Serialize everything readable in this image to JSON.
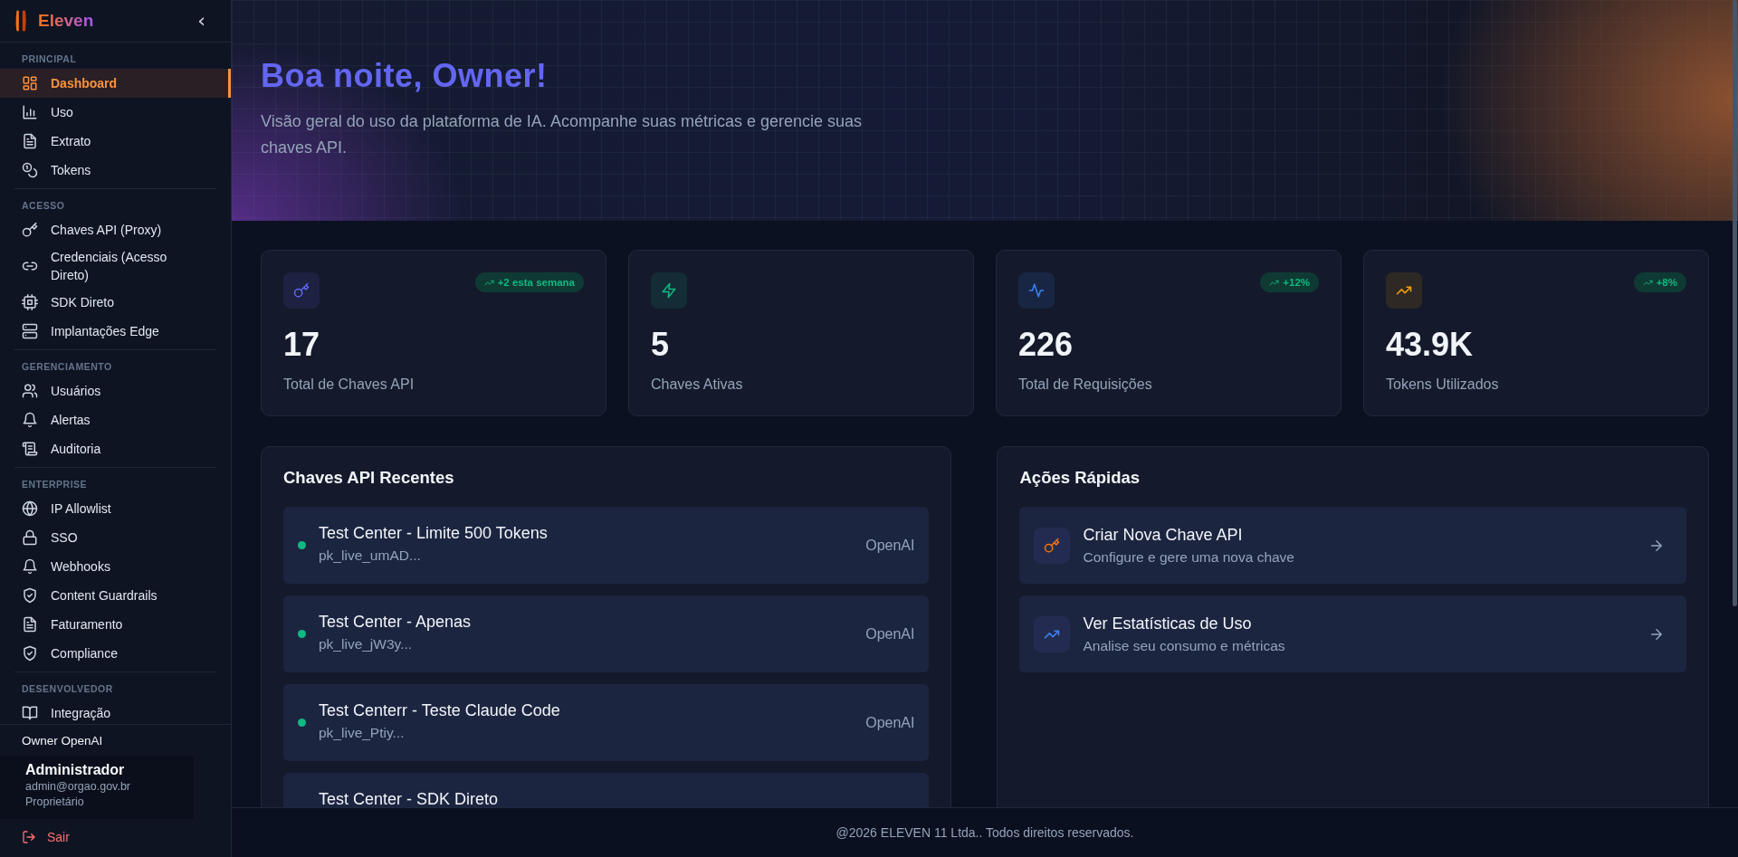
{
  "sidebar": {
    "logo": "Eleven",
    "collapse": "‹",
    "sections": [
      {
        "label": "PRINCIPAL",
        "items": [
          {
            "label": "Dashboard",
            "selected": true
          },
          {
            "label": "Uso",
            "selected": false
          },
          {
            "label": "Extrato",
            "selected": false
          },
          {
            "label": "Tokens",
            "selected": false
          }
        ]
      },
      {
        "label": "ACESSO",
        "items": [
          {
            "label": "Chaves API (Proxy)",
            "selected": false
          },
          {
            "label": "Credenciais (Acesso Direto)",
            "selected": false
          },
          {
            "label": "SDK Direto",
            "selected": false
          },
          {
            "label": "Implantações Edge",
            "selected": false
          }
        ]
      },
      {
        "label": "GERENCIAMENTO",
        "items": [
          {
            "label": "Usuários",
            "selected": false
          },
          {
            "label": "Alertas",
            "selected": false
          },
          {
            "label": "Auditoria",
            "selected": false
          }
        ]
      },
      {
        "label": "ENTERPRISE",
        "items": [
          {
            "label": "IP Allowlist",
            "selected": false
          },
          {
            "label": "SSO",
            "selected": false
          },
          {
            "label": "Webhooks",
            "selected": false
          },
          {
            "label": "Content Guardrails",
            "selected": false
          },
          {
            "label": "Faturamento",
            "selected": false
          },
          {
            "label": "Compliance",
            "selected": false
          }
        ]
      },
      {
        "label": "DESENVOLVEDOR",
        "items": [
          {
            "label": "Integração",
            "selected": false
          }
        ]
      }
    ],
    "account": "Owner OpenAI",
    "tooltip": {
      "name": "Administrador",
      "email": "admin@orgao.gov.br",
      "role": "Proprietário"
    },
    "logout": "Sair"
  },
  "header": {
    "title": "Boa noite, Owner!",
    "subtitle": "Visão geral do uso da plataforma de IA. Acompanhe suas métricas e gerencie suas chaves API."
  },
  "stats": [
    {
      "value": "17",
      "label": "Total de Chaves API",
      "badge": "+2 esta semana",
      "color": "#6366f1"
    },
    {
      "value": "5",
      "label": "Chaves Ativas",
      "color": "#10b981"
    },
    {
      "value": "226",
      "label": "Total de Requisições",
      "badge": "+12%",
      "color": "#3b82f6"
    },
    {
      "value": "43.9K",
      "label": "Tokens Utilizados",
      "badge": "+8%",
      "color": "#f59e0b"
    }
  ],
  "recent_keys": {
    "title": "Chaves API Recentes",
    "items": [
      {
        "name": "Test Center - Limite 500 Tokens",
        "key": "pk_live_umAD...",
        "provider": "OpenAI",
        "active": true
      },
      {
        "name": "Test Center - Apenas",
        "key": "pk_live_jW3y...",
        "provider": "OpenAI",
        "active": true
      },
      {
        "name": "Test Centerr - Teste Claude Code",
        "key": "pk_live_Ptiy...",
        "provider": "OpenAI",
        "active": true
      },
      {
        "name": "Test Center - SDK Direto"
      }
    ]
  },
  "quick_actions": {
    "title": "Ações Rápidas",
    "items": [
      {
        "title": "Criar Nova Chave API",
        "description": "Configure e gere uma nova chave",
        "color": "#f97316"
      },
      {
        "title": "Ver Estatísticas de Uso",
        "description": "Analise seu consumo e métricas",
        "color": "#3b82f6"
      }
    ]
  },
  "footer": "@2026 ELEVEN 11 Ltda.. Todos direitos reservados."
}
